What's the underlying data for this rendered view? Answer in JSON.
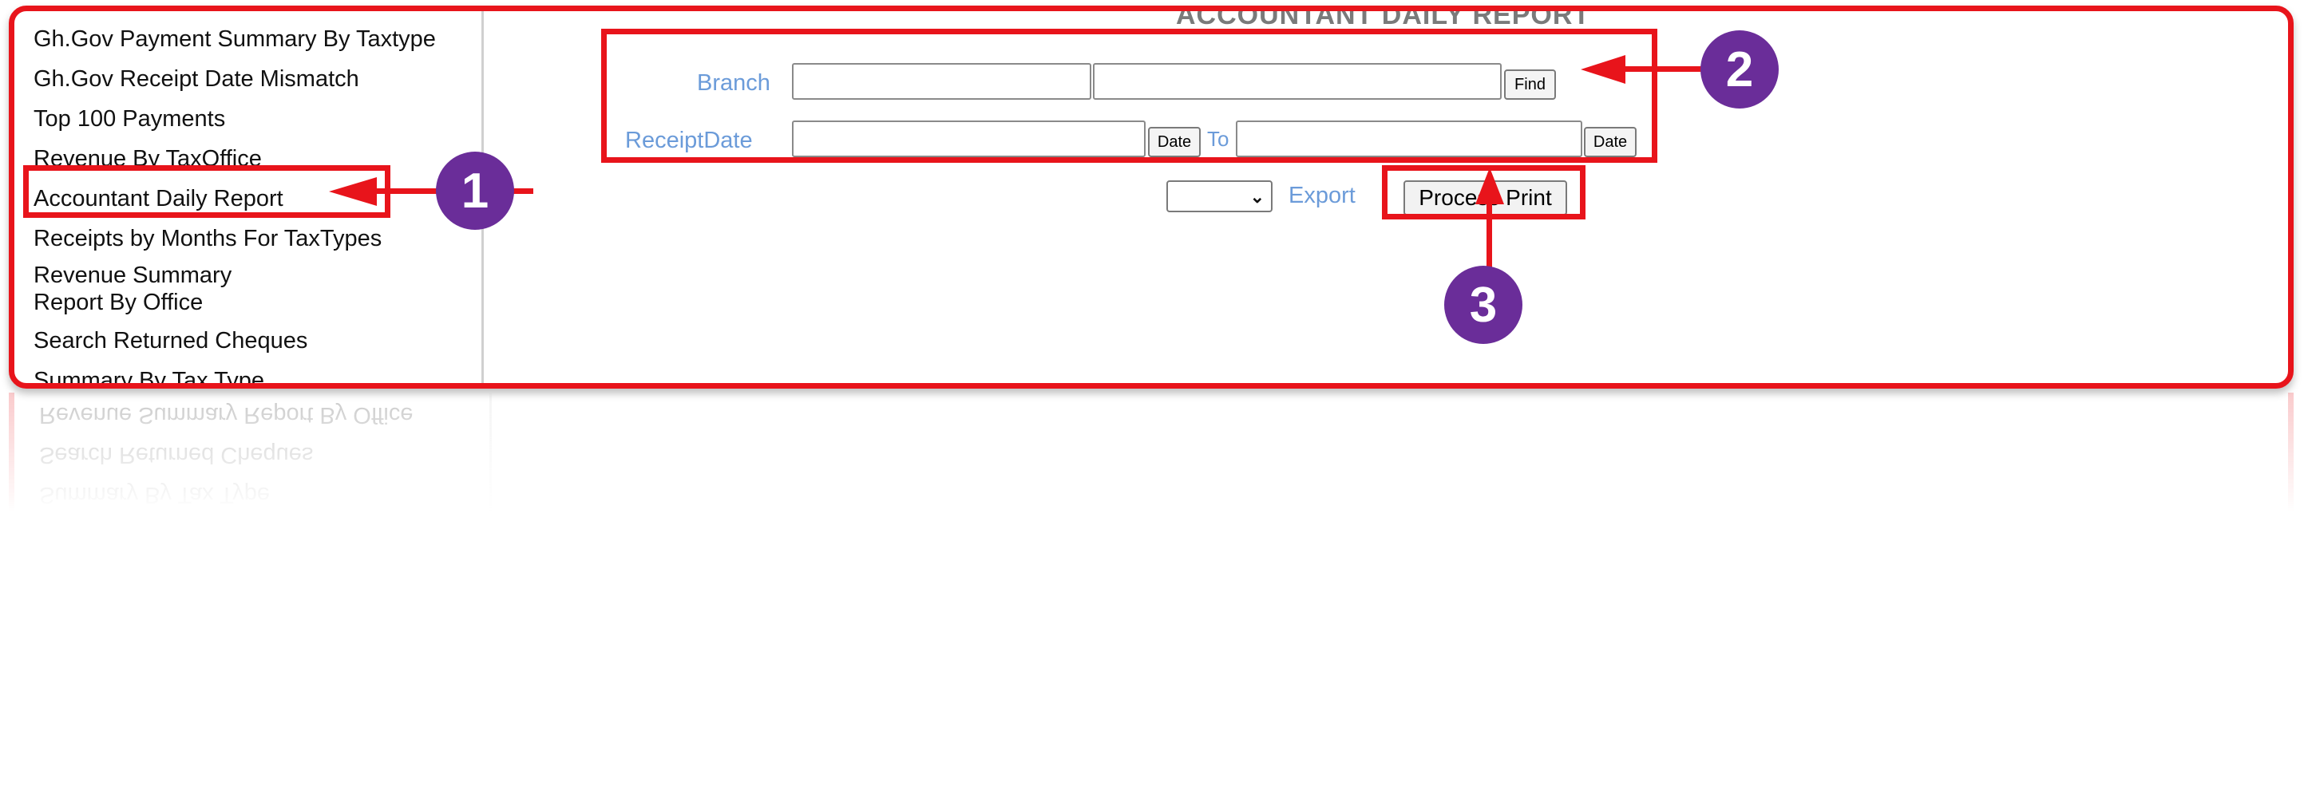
{
  "sidebar": {
    "items": [
      {
        "label": "Gh.Gov Payment Summary By Taxtype"
      },
      {
        "label": "Gh.Gov Receipt Date Mismatch"
      },
      {
        "label": "Top 100 Payments"
      },
      {
        "label": "Revenue By TaxOffice"
      },
      {
        "label": "Accountant Daily Report"
      },
      {
        "label": "Receipts by Months For TaxTypes"
      },
      {
        "label": "Revenue Summary Report By Office"
      },
      {
        "label": "Search Returned Cheques"
      },
      {
        "label": "Summary By Tax Type"
      }
    ]
  },
  "main": {
    "title": "ACCOUNTANT DAILY REPORT",
    "branch_label": "Branch",
    "branch_code_value": "",
    "branch_name_value": "",
    "find_label": "Find",
    "receipt_date_label": "ReceiptDate",
    "date_from_value": "",
    "date_button_label": "Date",
    "to_label": "To",
    "date_to_value": "",
    "export_select_value": "",
    "export_label": "Export",
    "process_label": "Process Print"
  },
  "annotations": {
    "badge1": "1",
    "badge2": "2",
    "badge3": "3",
    "highlight_color": "#e8141b",
    "badge_color": "#6a2d99"
  }
}
